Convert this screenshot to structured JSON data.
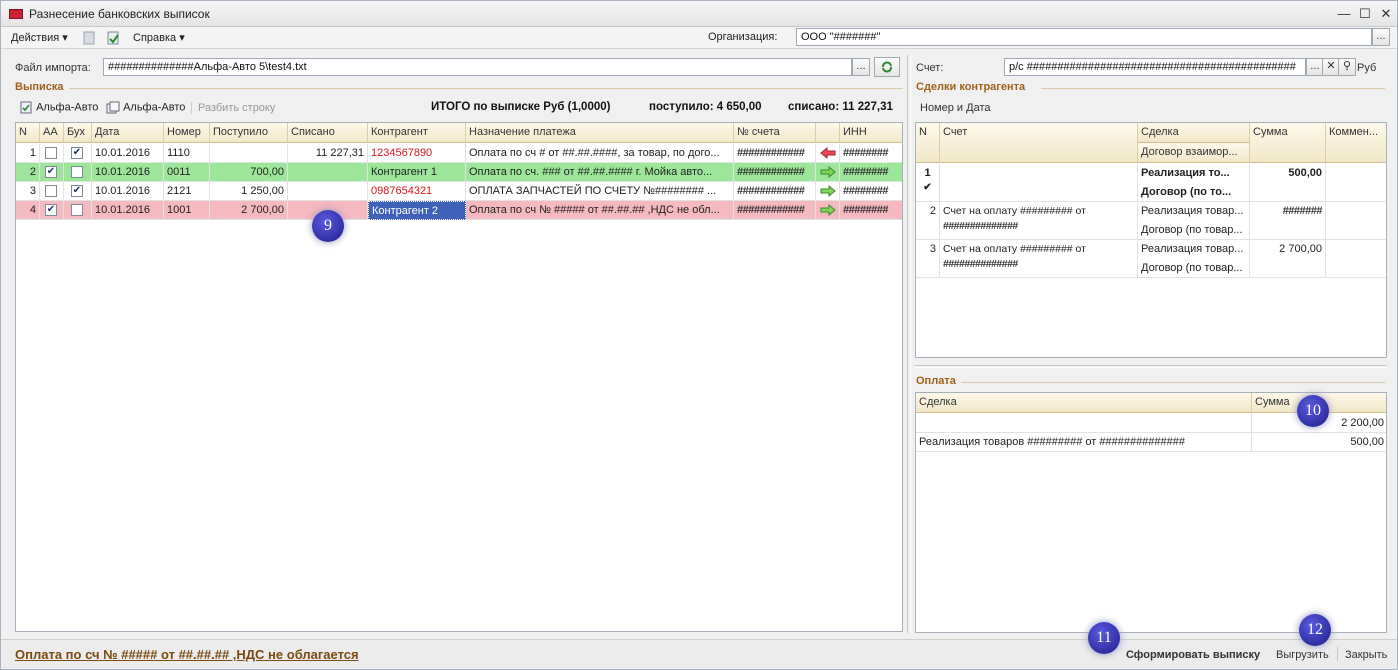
{
  "window": {
    "title": "Разнесение банковских выписок"
  },
  "menu": {
    "actions": "Действия",
    "help": "Справка",
    "org_label": "Организация:",
    "org_value": "ООО \"#######\""
  },
  "import": {
    "label": "Файл импорта:",
    "path": "##############Альфа-Авто 5\\test4.txt",
    "account_label": "Счет:",
    "account_value": "р/с ############################################",
    "currency": "Руб"
  },
  "statement": {
    "section": "Выписка",
    "tb_btn1": "Альфа-Авто",
    "tb_btn2": "Альфа-Авто",
    "tb_btn3": "Разбить строку",
    "total": "ИТОГО по выписке Руб (1,0000)",
    "received": "поступило: 4 650,00",
    "spent": "списано: 11 227,31",
    "columns": [
      "N",
      "АА",
      "Бух",
      "Дата",
      "Номер",
      "Поступило",
      "Списано",
      "Контрагент",
      "Назначение платежа",
      "№ счета",
      "",
      "ИНН"
    ],
    "rows": [
      {
        "n": "1",
        "aa": "",
        "buh": "✔",
        "date": "10.01.2016",
        "num": "1110",
        "in": "",
        "out": "11 227,31",
        "contr": "1234567890",
        "purpose": "Оплата по сч # от ##.##.####, за товар, по дого...",
        "acc": "############",
        "inn": "########"
      },
      {
        "n": "2",
        "aa": "✔",
        "buh": "",
        "date": "10.01.2016",
        "num": "0011",
        "in": "700,00",
        "out": "",
        "contr": "Контрагент 1",
        "purpose": "Оплата по сч. ### от ##.##.#### г. Мойка авто...",
        "acc": "############",
        "inn": "########"
      },
      {
        "n": "3",
        "aa": "",
        "buh": "✔",
        "date": "10.01.2016",
        "num": "2121",
        "in": "1 250,00",
        "out": "",
        "contr": "0987654321",
        "purpose": "ОПЛАТА ЗАПЧАСТЕЙ ПО СЧЕТУ №######## ...",
        "acc": "############",
        "inn": "########"
      },
      {
        "n": "4",
        "aa": "✔",
        "buh": "",
        "date": "10.01.2016",
        "num": "1001",
        "in": "2 700,00",
        "out": "",
        "contr": "Контрагент 2",
        "purpose": "Оплата по сч № ##### от ##.##.## ,НДС не обл...",
        "acc": "############",
        "inn": "########"
      }
    ]
  },
  "deals": {
    "section": "Сделки контрагента",
    "sort": "Номер и Дата",
    "columns": {
      "n": "N",
      "acc": "Счет",
      "deal": "Сделка",
      "contract": "Договор взаимор...",
      "sum": "Сумма",
      "comment": "Коммен..."
    },
    "rows": [
      {
        "n": "1",
        "acc1": "",
        "acc2": "",
        "deal": "Реализация то...",
        "contract": "Договор (по то...",
        "sum": "500,00"
      },
      {
        "n": "2",
        "acc1": "Счет на оплату ######### от",
        "acc2": "##############",
        "deal": "Реализация товар...",
        "contract": "Договор (по товар...",
        "sum": "#######"
      },
      {
        "n": "3",
        "acc1": "Счет на оплату ######### от",
        "acc2": "##############",
        "deal": "Реализация товар...",
        "contract": "Договор (по товар...",
        "sum": "2 700,00"
      }
    ]
  },
  "payment": {
    "section": "Оплата",
    "columns": {
      "deal": "Сделка",
      "sum": "Сумма"
    },
    "rows": [
      {
        "deal": "",
        "sum": "2 200,00"
      },
      {
        "deal": "Реализация товаров ######### от ##############",
        "sum": "500,00"
      }
    ]
  },
  "footer": {
    "status": "Оплата по сч № ##### от ##.##.## ,НДС не облагается",
    "form": "Сформировать выписку",
    "export": "Выгрузить",
    "close": "Закрыть"
  },
  "badges": [
    "9",
    "10",
    "11",
    "12"
  ]
}
